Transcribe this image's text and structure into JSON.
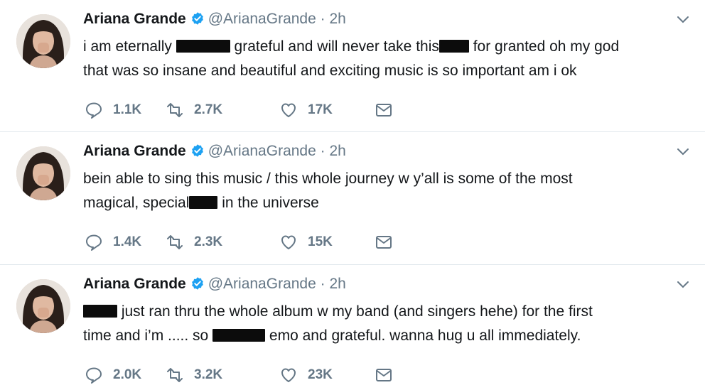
{
  "tweets": [
    {
      "name": "Ariana Grande",
      "handle": "@ArianaGrande",
      "dot": "·",
      "time": "2h",
      "lines": [
        [
          "i am eternally ",
          "[redacted]",
          " grateful and will never take this",
          "[redacted]",
          " for granted oh my god"
        ],
        [
          "that was so insane and beautiful and exciting music is so important am i ok"
        ]
      ],
      "replies": "1.1K",
      "retweets": "2.7K",
      "likes": "17K"
    },
    {
      "name": "Ariana Grande",
      "handle": "@ArianaGrande",
      "dot": "·",
      "time": "2h",
      "lines": [
        [
          "bein able to sing this music / this whole journey w y’all is some of the most"
        ],
        [
          "magical, special",
          "[redacted]",
          " in the universe"
        ]
      ],
      "replies": "1.4K",
      "retweets": "2.3K",
      "likes": "15K"
    },
    {
      "name": "Ariana Grande",
      "handle": "@ArianaGrande",
      "dot": "·",
      "time": "2h",
      "lines": [
        [
          "[redacted]",
          " just ran thru the whole album w my band (and singers hehe) for the first"
        ],
        [
          "time and i’m ..... so ",
          "[redacted]",
          " emo and grateful. wanna hug u all immediately."
        ]
      ],
      "replies": "2.0K",
      "retweets": "3.2K",
      "likes": "23K"
    }
  ],
  "icons": {
    "verified": "verified-badge-icon",
    "caret": "chevron-down-icon",
    "reply": "reply-icon",
    "retweet": "retweet-icon",
    "like": "heart-icon",
    "dm": "envelope-icon"
  },
  "colors": {
    "verified": "#1da1f2",
    "muted": "#657786",
    "text": "#14171a",
    "divider": "#e1e8ed"
  }
}
